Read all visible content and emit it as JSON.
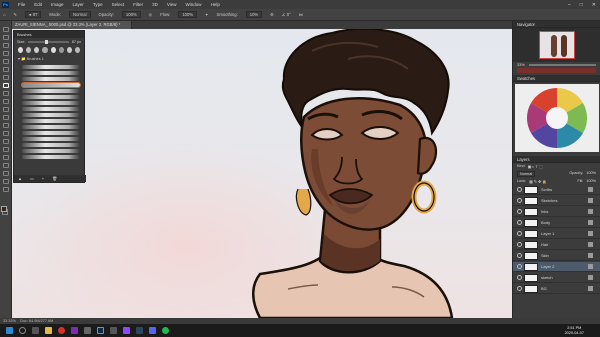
{
  "menu": {
    "app_icon": "Ps",
    "items": [
      "File",
      "Edit",
      "Image",
      "Layer",
      "Type",
      "Select",
      "Filter",
      "3D",
      "View",
      "Window",
      "Help"
    ]
  },
  "options": {
    "mode_label": "Mode:",
    "mode_value": "Normal",
    "opacity_label": "Opacity:",
    "opacity_value": "100%",
    "flow_label": "Flow:",
    "flow_value": "100%",
    "smoothing_label": "Smoothing:",
    "smoothing_value": "10%"
  },
  "document": {
    "tab_title": "ZAURI_SIENNA_ 5000.psd @ 33.3% (Layer 2, RGB/8) *"
  },
  "brushes_panel": {
    "title": "Brushes",
    "size_label": "Size:",
    "size_value": "87 px",
    "folder": "Brushes 1"
  },
  "navigator": {
    "title": "Navigator",
    "zoom": "33%"
  },
  "swatches": {
    "title": "Swatches"
  },
  "layers_panel": {
    "title": "Layers",
    "kind_label": "Kind",
    "blend_mode": "Normal",
    "opacity_label": "Opacity:",
    "opacity_value": "100%",
    "lock_label": "Lock:",
    "fill_label": "Fill:",
    "fill_value": "100%",
    "layers": [
      {
        "name": "Scribs"
      },
      {
        "name": "Sketches"
      },
      {
        "name": "Inks"
      },
      {
        "name": "Body"
      },
      {
        "name": "Layer 1"
      },
      {
        "name": "Hair"
      },
      {
        "name": "Skin"
      },
      {
        "name": "Layer 2"
      },
      {
        "name": "sketch"
      },
      {
        "name": "BG"
      }
    ]
  },
  "status": {
    "zoom": "33.33%",
    "doc_info": "Doc: 64.9M/277.6M"
  },
  "taskbar": {
    "time": "2:51 PM",
    "date": "2020-04-07"
  },
  "colors": {
    "foreground": "#3a2418",
    "background": "#ffffff"
  }
}
